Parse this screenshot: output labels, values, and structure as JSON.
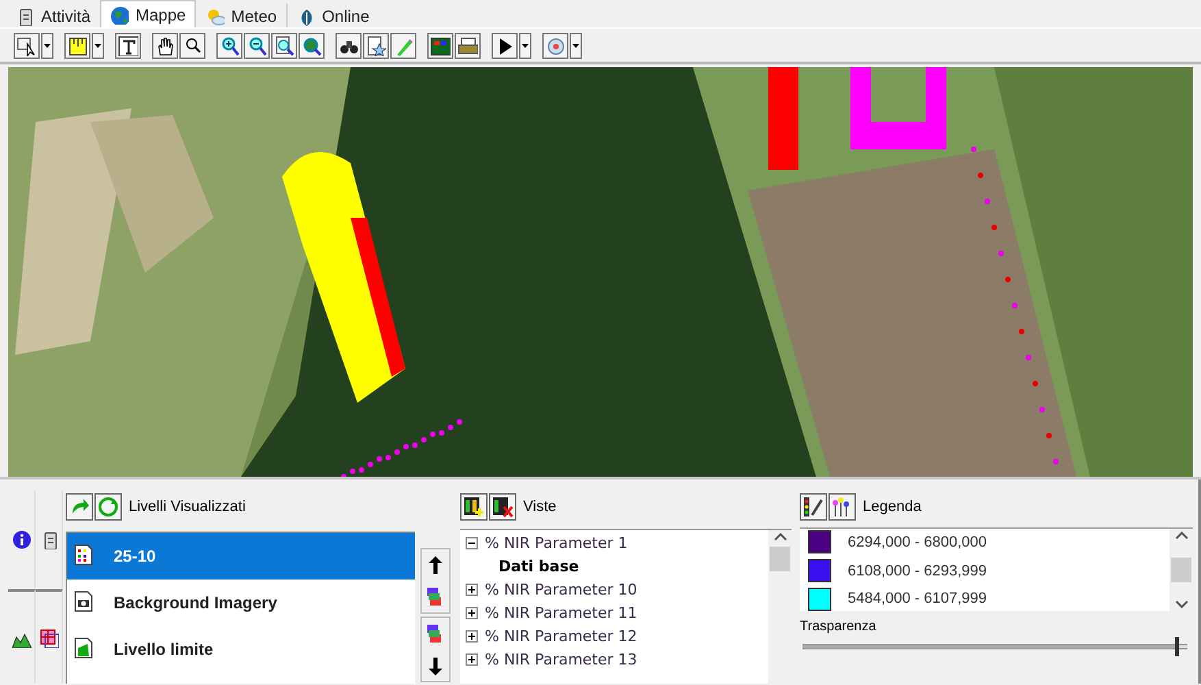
{
  "tabs": [
    {
      "label": "Attività",
      "selected": false
    },
    {
      "label": "Mappe",
      "selected": true
    },
    {
      "label": "Meteo",
      "selected": false
    },
    {
      "label": "Online",
      "selected": false
    }
  ],
  "layers": {
    "title": "Livelli Visualizzati",
    "items": [
      {
        "label": "25-10",
        "kind": "points",
        "selected": true
      },
      {
        "label": "Background Imagery",
        "kind": "imagery",
        "selected": false
      },
      {
        "label": "Livello limite",
        "kind": "boundary",
        "selected": false
      }
    ]
  },
  "views": {
    "title": "Viste",
    "items": [
      {
        "label": "% NIR Parameter 1",
        "expanded": true,
        "selected": false,
        "children": [
          {
            "label": "Dati base",
            "selected": true
          }
        ]
      },
      {
        "label": "% NIR Parameter 10",
        "expanded": false,
        "selected": false
      },
      {
        "label": "% NIR Parameter 11",
        "expanded": false,
        "selected": false
      },
      {
        "label": "% NIR Parameter 12",
        "expanded": false,
        "selected": false
      },
      {
        "label": "% NIR Parameter 13",
        "expanded": false,
        "selected": false
      }
    ]
  },
  "legend": {
    "title": "Legenda",
    "items": [
      {
        "label": "6294,000 - 6800,000",
        "color": "#4b0082"
      },
      {
        "label": "6108,000 - 6293,999",
        "color": "#3a10f0"
      },
      {
        "label": "5484,000 - 6107,999",
        "color": "#00ffff"
      }
    ],
    "transparency": {
      "label": "Trasparenza",
      "level": 0.97
    }
  }
}
